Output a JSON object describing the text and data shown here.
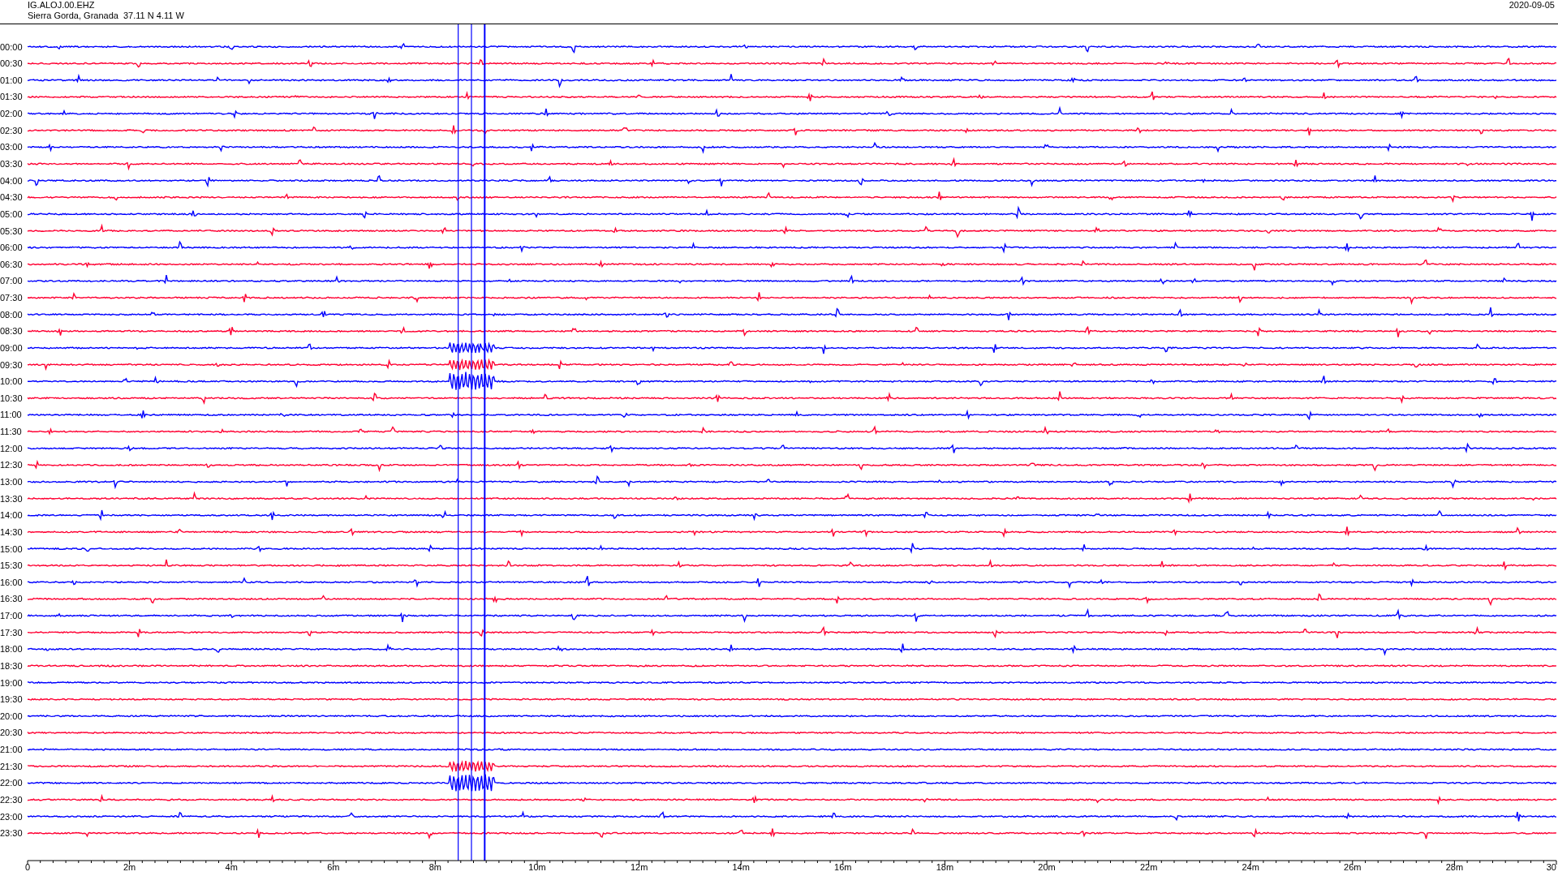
{
  "header": {
    "station": "IG.ALOJ.00.EHZ",
    "location": "Sierra Gorda, Granada  37.11 N 4.11 W",
    "date": "2020-09-05"
  },
  "rows": [
    {
      "label": "00:00",
      "color": "#0000ff"
    },
    {
      "label": "00:30",
      "color": "#ff0033"
    },
    {
      "label": "01:00",
      "color": "#0000ff"
    },
    {
      "label": "01:30",
      "color": "#ff0033"
    },
    {
      "label": "02:00",
      "color": "#0000ff"
    },
    {
      "label": "02:30",
      "color": "#ff0033"
    },
    {
      "label": "03:00",
      "color": "#0000ff"
    },
    {
      "label": "03:30",
      "color": "#ff0033"
    },
    {
      "label": "04:00",
      "color": "#0000ff"
    },
    {
      "label": "04:30",
      "color": "#ff0033"
    },
    {
      "label": "05:00",
      "color": "#0000ff"
    },
    {
      "label": "05:30",
      "color": "#ff0033"
    },
    {
      "label": "06:00",
      "color": "#0000ff"
    },
    {
      "label": "06:30",
      "color": "#ff0033"
    },
    {
      "label": "07:00",
      "color": "#0000ff"
    },
    {
      "label": "07:30",
      "color": "#ff0033"
    },
    {
      "label": "08:00",
      "color": "#0000ff"
    },
    {
      "label": "08:30",
      "color": "#ff0033"
    },
    {
      "label": "09:00",
      "color": "#0000ff"
    },
    {
      "label": "09:30",
      "color": "#ff0033"
    },
    {
      "label": "10:00",
      "color": "#0000ff"
    },
    {
      "label": "10:30",
      "color": "#ff0033"
    },
    {
      "label": "11:00",
      "color": "#0000ff"
    },
    {
      "label": "11:30",
      "color": "#ff0033"
    },
    {
      "label": "12:00",
      "color": "#0000ff"
    },
    {
      "label": "12:30",
      "color": "#ff0033"
    },
    {
      "label": "13:00",
      "color": "#0000ff"
    },
    {
      "label": "13:30",
      "color": "#ff0033"
    },
    {
      "label": "14:00",
      "color": "#0000ff"
    },
    {
      "label": "14:30",
      "color": "#ff0033"
    },
    {
      "label": "15:00",
      "color": "#0000ff"
    },
    {
      "label": "15:30",
      "color": "#ff0033"
    },
    {
      "label": "16:00",
      "color": "#0000ff"
    },
    {
      "label": "16:30",
      "color": "#ff0033"
    },
    {
      "label": "17:00",
      "color": "#0000ff"
    },
    {
      "label": "17:30",
      "color": "#ff0033"
    },
    {
      "label": "18:00",
      "color": "#0000ff"
    },
    {
      "label": "18:30",
      "color": "#ff0033"
    },
    {
      "label": "19:00",
      "color": "#0000ff"
    },
    {
      "label": "19:30",
      "color": "#ff0033"
    },
    {
      "label": "20:00",
      "color": "#0000ff"
    },
    {
      "label": "20:30",
      "color": "#ff0033"
    },
    {
      "label": "21:00",
      "color": "#0000ff"
    },
    {
      "label": "21:30",
      "color": "#ff0033"
    },
    {
      "label": "22:00",
      "color": "#0000ff"
    },
    {
      "label": "22:30",
      "color": "#ff0033"
    },
    {
      "label": "23:00",
      "color": "#0000ff"
    },
    {
      "label": "23:30",
      "color": "#ff0033"
    }
  ],
  "x_axis": {
    "ticks": [
      "0",
      "2m",
      "4m",
      "6m",
      "8m",
      "10m",
      "12m",
      "14m",
      "16m",
      "18m",
      "20m",
      "22m",
      "24m",
      "26m",
      "28m",
      "30"
    ]
  }
}
